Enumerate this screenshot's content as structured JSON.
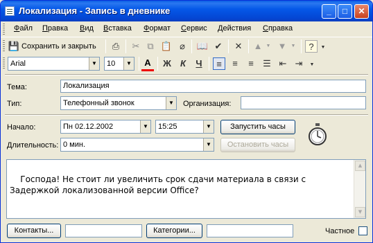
{
  "window": {
    "title": "Локализация - Запись в дневнике"
  },
  "menu": [
    "Файл",
    "Правка",
    "Вид",
    "Вставка",
    "Формат",
    "Сервис",
    "Действия",
    "Справка"
  ],
  "toolbar": {
    "save_close_label": "Сохранить и закрыть"
  },
  "format": {
    "font": "Arial",
    "size": "10",
    "bold": "Ж",
    "italic": "К",
    "underline": "Ч"
  },
  "form": {
    "subject_label": "Тема:",
    "subject_value": "Локализация",
    "type_label": "Тип:",
    "type_value": "Телефонный звонок",
    "company_label": "Организация:",
    "company_value": "",
    "start_label": "Начало:",
    "start_date": "Пн 02.12.2002",
    "start_time": "15:25",
    "start_timer_button": "Запустить часы",
    "duration_label": "Длительность:",
    "duration_value": "0 мин.",
    "stop_timer_button": "Остановить часы"
  },
  "body_text": "Господа! Не стоит ли увеличить срок сдачи материала в связи с\nЗадержкой локализованной версии Office?",
  "footer": {
    "contacts_button": "Контакты...",
    "contacts_value": "",
    "categories_button": "Категории...",
    "categories_value": "",
    "private_label": "Частное"
  }
}
